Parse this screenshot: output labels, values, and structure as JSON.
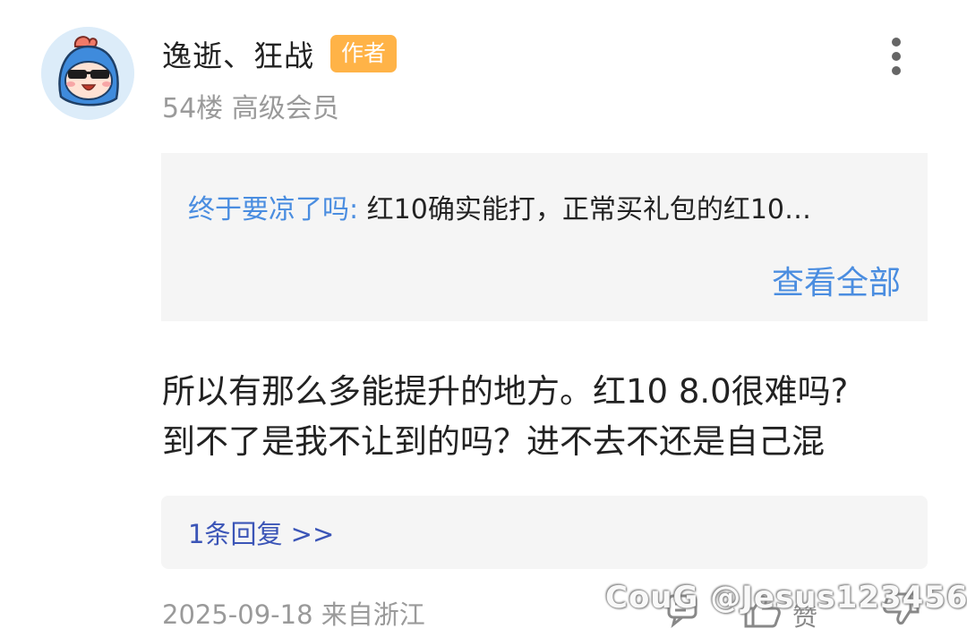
{
  "post": {
    "author": "逸逝、狂战",
    "author_badge": "作者",
    "floor_meta": "54楼 高级会员",
    "quote": {
      "user": "终于要凉了吗:",
      "text": " 红10确实能打，正常买礼包的红10…",
      "view_all": "查看全部"
    },
    "content_lines": [
      "所以有那么多能提升的地方。红10 8.0很难吗?",
      "到不了是我不让到的吗？进不去不还是自己混"
    ],
    "reply_link": "1条回复 >>",
    "date_location": "2025-09-18 来自浙江",
    "like_label": "赞",
    "watermark": "CouG @Jesus123456"
  },
  "icons": {
    "avatar": "cartoon-avatar-icon",
    "more": "more-vertical-icon",
    "comment": "comment-icon",
    "like": "thumb-up-icon",
    "dislike": "thumb-down-icon"
  },
  "colors": {
    "badge": "#ffb347",
    "link_blue": "#4a8de0",
    "reply_blue": "#3b55b7",
    "muted": "#9a9a9a",
    "panel_bg": "#f5f5f5"
  }
}
